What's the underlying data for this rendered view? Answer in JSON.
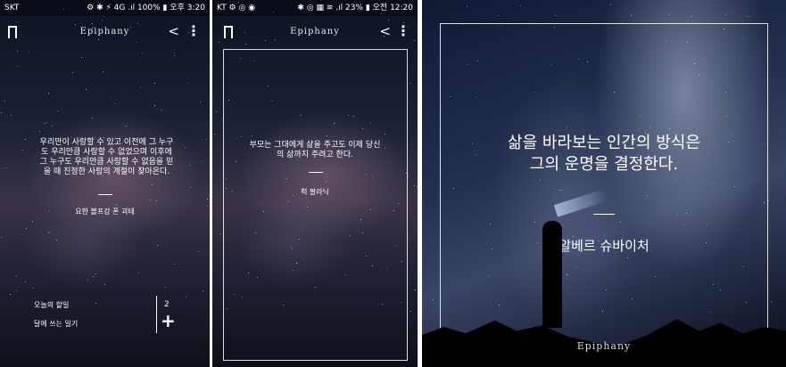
{
  "screen1": {
    "status_left": "SKT",
    "status_right": "⚙ ✱ ⚡ 4G .ıl 100% ▮ 오후 3:20",
    "logo": "Epiphany",
    "quote": "우리만이 사랑할 수 있고 이전에 그 누구도 우리만큼 사랑할 수 없었으며 이후에 그 누구도 우리만큼 사랑할 수 없음을 믿을 때 진정한 사랑의 계절이 찾아온다.",
    "author": "요한 볼프강 폰 괴테",
    "menu_item_1": "오늘의 할일",
    "menu_item_2": "달에 쓰는 일기",
    "count": "2",
    "add_label": "+"
  },
  "screen2": {
    "status_left": "KT ⚙ ◎ ◉",
    "status_right": "✱ ◎ ▦ ≋ .ıl 23% ▮ 오전 12:20",
    "logo": "Epiphany",
    "quote": "부모는 그대에게 삶을 주고도 이제 당신의 삶까지 주려고 한다.",
    "author": "척 팔라닉"
  },
  "screen3": {
    "quote_line1": "삶을 바라보는 인간의 방식은",
    "quote_line2": "그의 운명을 결정한다.",
    "author": "알베르 슈바이처",
    "logo": "Epiphany"
  },
  "colors": {
    "text": "#ffffff",
    "sky_dark": "#0d1322"
  }
}
